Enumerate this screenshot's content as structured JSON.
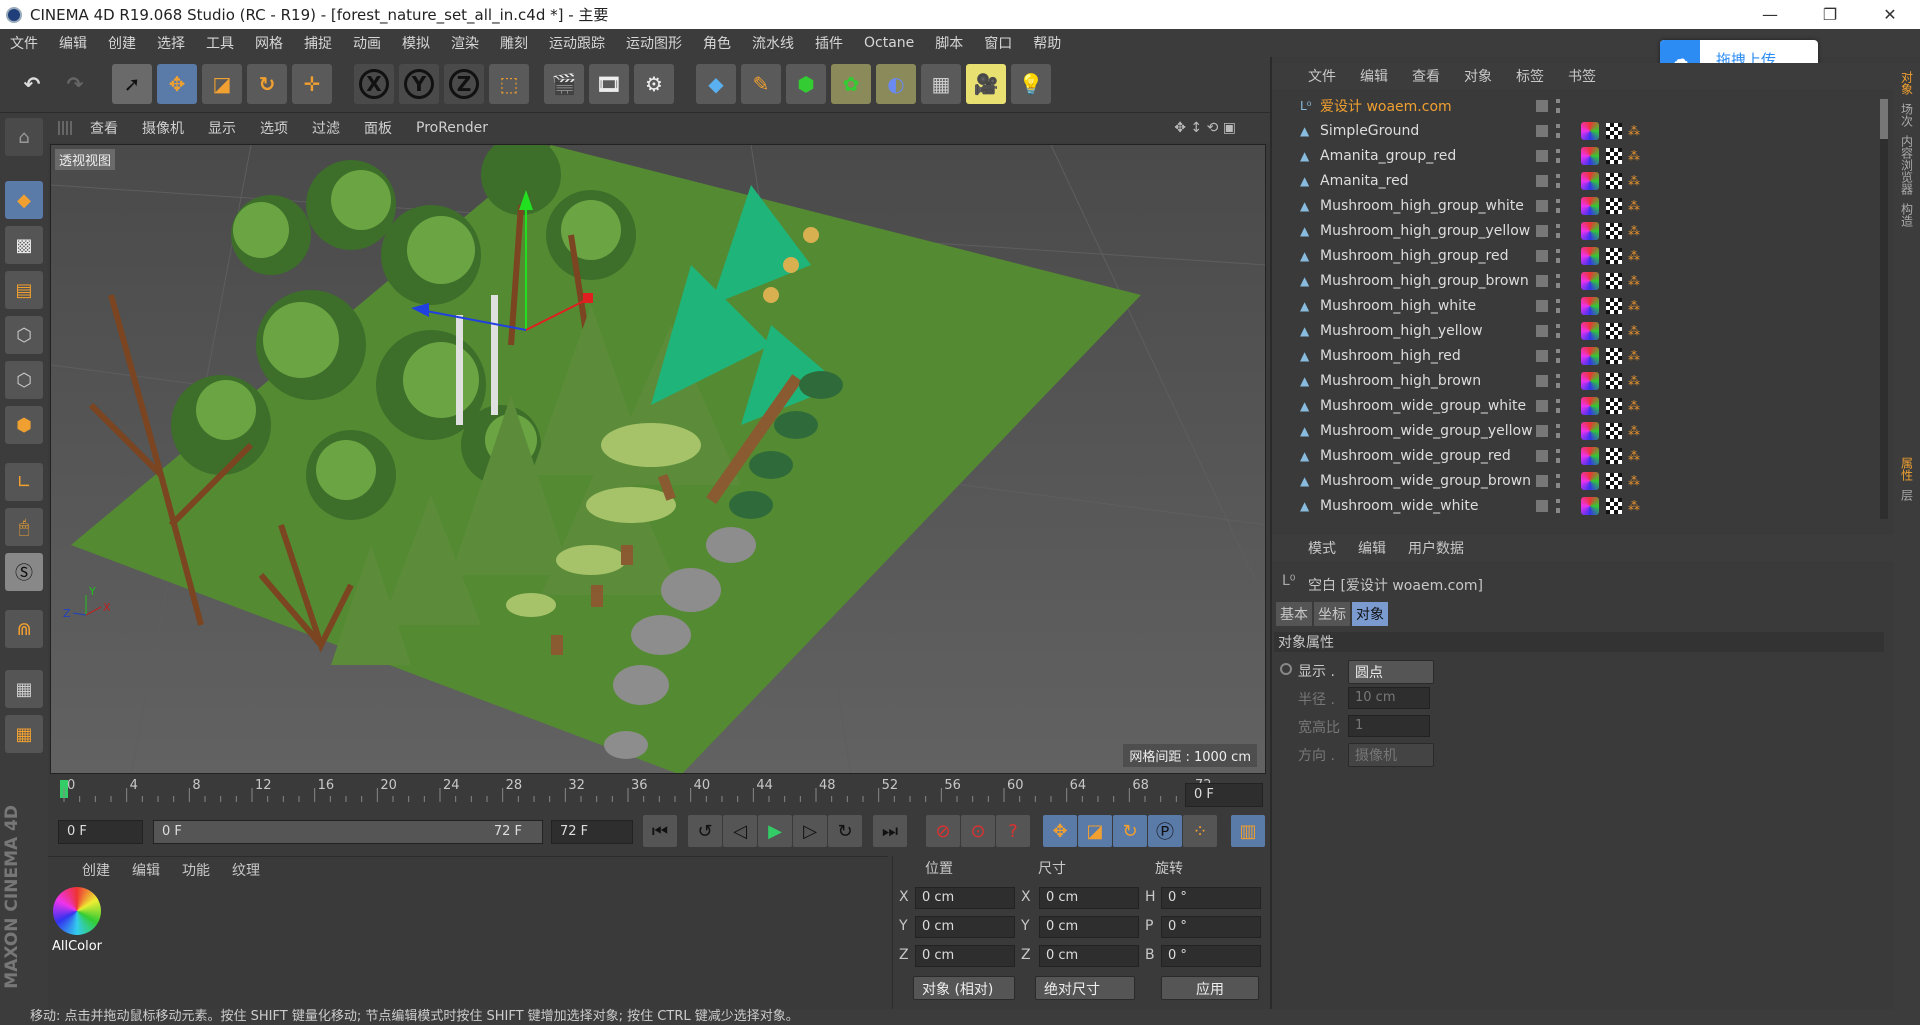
{
  "window": {
    "title": "CINEMA 4D R19.068 Studio (RC - R19) - [forest_nature_set_all_in.c4d *] - 主要"
  },
  "menubar": [
    "文件",
    "编辑",
    "创建",
    "选择",
    "工具",
    "网格",
    "捕捉",
    "动画",
    "模拟",
    "渲染",
    "雕刻",
    "运动跟踪",
    "运动图形",
    "角色",
    "流水线",
    "插件",
    "Octane",
    "脚本",
    "窗口",
    "帮助"
  ],
  "upload_button": {
    "label": "拖拽上传"
  },
  "viewport": {
    "menu": [
      "查看",
      "摄像机",
      "显示",
      "选项",
      "过滤",
      "面板",
      "ProRender"
    ],
    "label": "透视视图",
    "grid_spacing": "网格间距 : 1000 cm"
  },
  "timeline": {
    "ticks": [
      "0",
      "4",
      "8",
      "12",
      "16",
      "20",
      "24",
      "28",
      "32",
      "36",
      "40",
      "44",
      "48",
      "52",
      "56",
      "60",
      "64",
      "68",
      "72"
    ],
    "end_field": "0 F"
  },
  "playback": {
    "start": "0 F",
    "range_start": "0 F",
    "range_end": "72 F",
    "end": "72 F"
  },
  "material_panel": {
    "tabs": [
      "创建",
      "编辑",
      "功能",
      "纹理"
    ],
    "material_name": "AllColor"
  },
  "coord_panel": {
    "headers": {
      "position": "位置",
      "size": "尺寸",
      "rotation": "旋转"
    },
    "rows": [
      {
        "axis": "X",
        "pos": "0 cm",
        "saxis": "X",
        "size": "0 cm",
        "raxis": "H",
        "rot": "0 °"
      },
      {
        "axis": "Y",
        "pos": "0 cm",
        "saxis": "Y",
        "size": "0 cm",
        "raxis": "P",
        "rot": "0 °"
      },
      {
        "axis": "Z",
        "pos": "0 cm",
        "saxis": "Z",
        "size": "0 cm",
        "raxis": "B",
        "rot": "0 °"
      }
    ],
    "mode": "对象 (相对)",
    "size_mode": "绝对尺寸",
    "apply": "应用"
  },
  "object_manager": {
    "menu": [
      "文件",
      "编辑",
      "查看",
      "对象",
      "标签",
      "书签"
    ],
    "objects": [
      "爱设计 woaem.com",
      "SimpleGround",
      "Amanita_group_red",
      "Amanita_red",
      "Mushroom_high_group_white",
      "Mushroom_high_group_yellow",
      "Mushroom_high_group_red",
      "Mushroom_high_group_brown",
      "Mushroom_high_white",
      "Mushroom_high_yellow",
      "Mushroom_high_red",
      "Mushroom_high_brown",
      "Mushroom_wide_group_white",
      "Mushroom_wide_group_yellow",
      "Mushroom_wide_group_red",
      "Mushroom_wide_group_brown",
      "Mushroom_wide_white"
    ],
    "highlight_color": "#f0a030"
  },
  "attribute_manager": {
    "menu": [
      "模式",
      "编辑",
      "用户数据"
    ],
    "object_title": "空白 [爱设计 woaem.com]",
    "tabs": [
      "基本",
      "坐标",
      "对象"
    ],
    "section": "对象属性",
    "fields": [
      {
        "label": "显示 .",
        "value": "圆点"
      },
      {
        "label": "半径 .",
        "value": "10 cm"
      },
      {
        "label": "宽高比",
        "value": "1"
      },
      {
        "label": "方向 .",
        "value": "摄像机"
      }
    ]
  },
  "right_strip": [
    "对象",
    "场次",
    "内容浏览器",
    "构造",
    "属性",
    "层"
  ],
  "statusbar": "移动: 点击并拖动鼠标移动元素。按住 SHIFT 键量化移动; 节点编辑模式时按住 SHIFT 键增加选择对象; 按住 CTRL 键减少选择对象。",
  "brand": "MAXON CINEMA 4D"
}
